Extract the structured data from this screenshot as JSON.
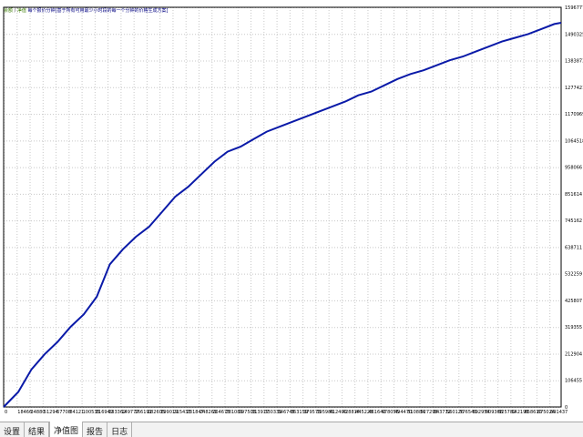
{
  "legend": {
    "part1": "余额",
    "sep": " / ",
    "part2": "净值",
    "part3": "每个报价分钟[基于所有可用最少小时段的每一个分钟的价格生成方案]"
  },
  "tabs": [
    {
      "label": "设置",
      "active": false
    },
    {
      "label": "结果",
      "active": false
    },
    {
      "label": "净值图",
      "active": true
    },
    {
      "label": "报告",
      "active": false
    },
    {
      "label": "日志",
      "active": false
    }
  ],
  "colors": {
    "line": "#0a1aa8",
    "grid": "#c8c8c8",
    "axis": "#000000"
  },
  "chart_data": {
    "type": "line",
    "y_ticks": [
      0,
      106455,
      212904,
      319355,
      425807,
      532259,
      638711,
      745162,
      851614,
      958066,
      1064518,
      1170969,
      1277421,
      1383873,
      1490325,
      1596777
    ],
    "y_tick_labels": [
      "0",
      "106455",
      "212904",
      "319355",
      "425807",
      "532259",
      "638711",
      "745162",
      "851614",
      "958066",
      "1064518",
      "1170969",
      "1277421",
      "1383873",
      "1490325",
      "1596777"
    ],
    "x_tick_labels": [
      "0",
      "18466",
      "34880",
      "51294",
      "67708",
      "84121",
      "100535",
      "116949",
      "133362",
      "149777",
      "166191",
      "182605",
      "199019",
      "215433",
      "231847",
      "248261",
      "264675",
      "281089",
      "297503",
      "313917",
      "330331",
      "346745",
      "363159",
      "379573",
      "395986",
      "412400",
      "428814",
      "445228",
      "461642",
      "478056",
      "494470",
      "510884",
      "527298",
      "543712",
      "560126",
      "576540",
      "592954",
      "609368",
      "625782",
      "642196",
      "658610",
      "675024",
      "691437"
    ],
    "xlim": [
      0,
      700000
    ],
    "ylim": [
      0,
      1596777
    ],
    "grid": true,
    "series": [
      {
        "x": [
          0,
          18466,
          34880,
          51294,
          67708,
          84121,
          100535,
          116949,
          133362,
          149777,
          166191,
          182605,
          199019,
          215433,
          231847,
          248261,
          264675,
          281089,
          297503,
          313917,
          330331,
          346745,
          363159,
          379573,
          395986,
          412400,
          428814,
          445228,
          461642,
          478056,
          494470,
          510884,
          527298,
          543712,
          560126,
          576540,
          592954,
          609368,
          625782,
          642196,
          658610,
          675024,
          691437,
          700000
        ],
        "values": [
          0,
          60000,
          150000,
          210000,
          260000,
          320000,
          370000,
          440000,
          570000,
          630000,
          680000,
          720000,
          780000,
          840000,
          880000,
          930000,
          980000,
          1020000,
          1040000,
          1070000,
          1100000,
          1120000,
          1140000,
          1160000,
          1180000,
          1200000,
          1220000,
          1245000,
          1260000,
          1285000,
          1310000,
          1330000,
          1345000,
          1365000,
          1385000,
          1400000,
          1420000,
          1440000,
          1460000,
          1475000,
          1490000,
          1510000,
          1530000,
          1535000
        ]
      }
    ]
  }
}
